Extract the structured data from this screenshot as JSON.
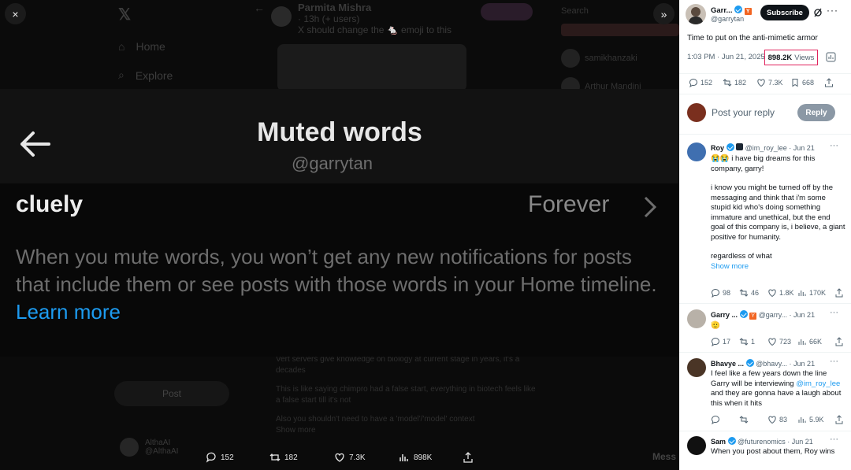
{
  "viewer": {
    "background": {
      "nav_items": [
        "Home",
        "Explore"
      ],
      "post_author": "Parmita Mishra",
      "post_meta": "· 13h (+ users)",
      "post_text": "X should change the 🐁 emoji to this",
      "right_users": [
        "Search",
        "samikhanzaki",
        "Arthur Mandini"
      ],
      "lower_lines": [
        "Vert servers give knowledge on biology at current stage in years, it's a decades",
        "This is like saying chimpro had a false start, everything in biotech feels like a false start till it's not",
        "Also you shouldn't need to have a 'model'/'model' context",
        "Show more"
      ],
      "post_button": "Post",
      "user_name": "AlthaAI",
      "user_handle": "@AlthaAI",
      "messages_label": "Mess"
    },
    "close_icon": "×",
    "expand_icon": "»",
    "panel": {
      "title": "Muted words",
      "handle": "@garrytan",
      "word": "cluely",
      "duration": "Forever",
      "description": "When you mute words, you won’t get any new notifications for posts that include them or see posts with those words in your Home timeline.",
      "learn_more": "Learn more"
    },
    "bottom_bar": {
      "replies": "152",
      "reposts": "182",
      "likes": "7.3K",
      "views": "898K"
    }
  },
  "thread": {
    "author_name": "Garr...",
    "author_handle": "@garrytan",
    "subscribe_label": "Subscribe",
    "post_text": "Time to put on the anti-mimetic armor",
    "post_time": "1:03 PM · Jun 21, 2025",
    "views_count": "898.2K",
    "views_label": "Views",
    "stats": {
      "replies": "152",
      "reposts": "182",
      "likes": "7.3K",
      "bookmarks": "668"
    },
    "reply_placeholder": "Post your reply",
    "reply_button": "Reply",
    "replies": [
      {
        "name": "Roy",
        "handle": "@im_roy_lee · Jun 21",
        "text": [
          "😭😭 i have big dreams for this company, garry!",
          "",
          "i know you might be turned off by the messaging and think that i'm some stupid kid who's doing something immature and unethical, but the end goal of this company is, i believe, a giant positive for humanity.",
          "",
          "regardless of what"
        ],
        "show_more": "Show more",
        "stats": {
          "replies": "98",
          "reposts": "46",
          "likes": "1.8K",
          "views": "170K"
        }
      },
      {
        "name": "Garry ...",
        "handle": "@garry... · Jun 21",
        "text": [
          "🫡"
        ],
        "stats": {
          "replies": "17",
          "reposts": "1",
          "likes": "723",
          "views": "66K"
        }
      },
      {
        "name": "Bhavye ...",
        "handle": "@bhavy... · Jun 21",
        "text_before": "I feel like a few years down the line Garry will be interviewing",
        "mention": "@im_roy_lee",
        "text_after": "and they are gonna have a laugh about this when it hits",
        "stats": {
          "replies": "",
          "reposts": "",
          "likes": "83",
          "views": "5.9K"
        }
      },
      {
        "name": "Sam",
        "handle": "@futurenomics · Jun 21",
        "text": [
          "When you post about them, Roy wins"
        ]
      }
    ]
  },
  "colors": {
    "accent": "#1d9bf0",
    "highlight_box": "#e0245e"
  }
}
